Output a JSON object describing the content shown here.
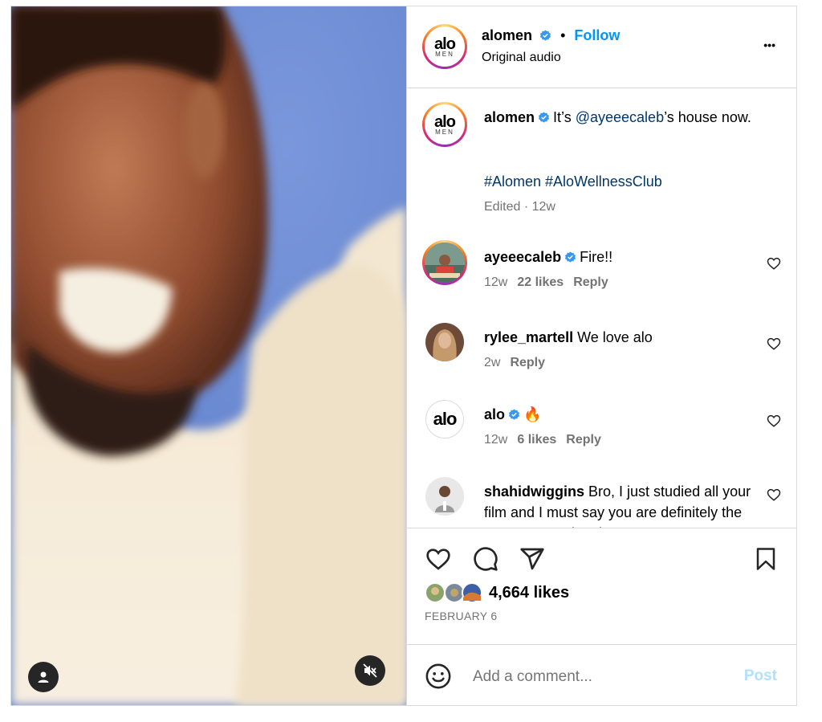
{
  "post": {
    "username": "alomen",
    "follow_label": "Follow",
    "separator": "•",
    "audio": "Original audio",
    "more": "•••"
  },
  "caption": {
    "username": "alomen",
    "text_prefix": "It’s",
    "mention": "@ayeeecaleb",
    "text_suffix": "’s house now.",
    "hashtags": "#Alomen #AloWellnessClub",
    "meta": "Edited · 12w"
  },
  "comments": [
    {
      "username": "ayeeecaleb",
      "text": "Fire!!",
      "time": "12w",
      "likes": "22 likes",
      "reply": "Reply"
    },
    {
      "username": "rylee_martell",
      "text": "We love alo",
      "time": "2w",
      "reply": "Reply"
    },
    {
      "username": "alo",
      "text": "🔥",
      "time": "12w",
      "likes": "6 likes",
      "reply": "Reply"
    },
    {
      "username": "shahidwiggins",
      "text": "Bro, I just studied all your film and I must say you are definitely the man! I’m praying that"
    }
  ],
  "logos": {
    "alo": "alo",
    "men": "MEN"
  },
  "stats": {
    "likes": "4,664 likes",
    "date": "FEBRUARY 6"
  },
  "composer": {
    "placeholder": "Add a comment...",
    "post_label": "Post"
  },
  "colors": {
    "accent": "#0095f6",
    "verified": "#3897f0",
    "link": "#00376b",
    "muted": "#737373",
    "post_disabled": "#b2dffc"
  },
  "icons": [
    "verified-icon",
    "more-icon",
    "heart-icon",
    "comment-icon",
    "share-icon",
    "bookmark-icon",
    "emoji-icon",
    "user-icon",
    "mute-icon"
  ]
}
